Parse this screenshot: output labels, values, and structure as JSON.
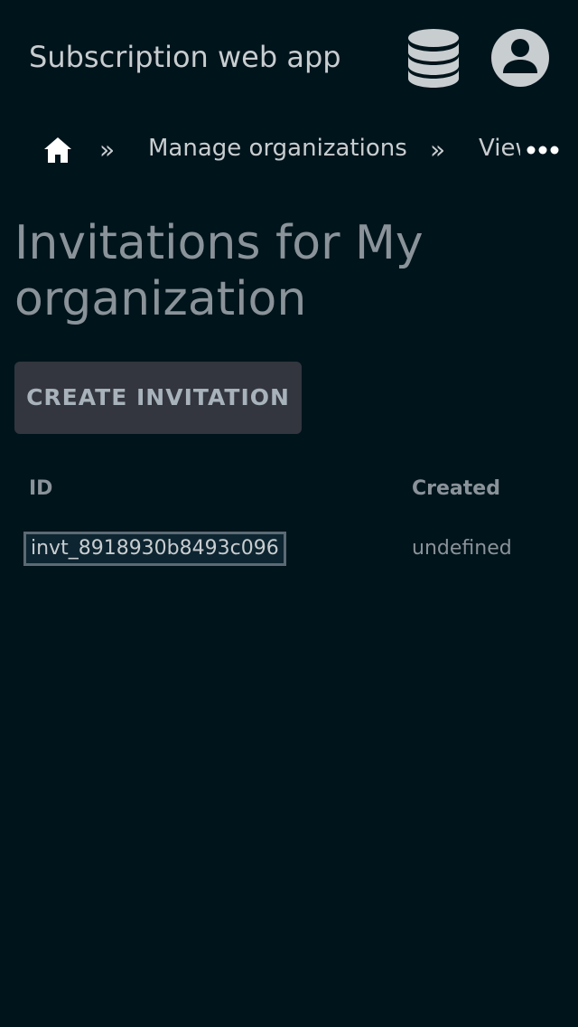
{
  "app_bar": {
    "title": "Subscription web app",
    "database_icon": "database-icon",
    "account_icon": "account-circle-icon"
  },
  "breadcrumb": {
    "home_icon": "home-icon",
    "separator": "»",
    "items": [
      {
        "label": "Manage organizations"
      },
      {
        "label": "View organization"
      }
    ],
    "more_icon": "more-horizontal-icon"
  },
  "page": {
    "title": "Invitations for My organization",
    "create_button_label": "CREATE INVITATION"
  },
  "table": {
    "columns": [
      "ID",
      "Created"
    ],
    "rows": [
      {
        "id": "invt_8918930b8493c096",
        "created": "undefined"
      }
    ]
  },
  "colors": {
    "background": "#00141b",
    "text": "#c8cdd0",
    "muted_text": "#8a9399",
    "button_bg": "#33363e"
  }
}
